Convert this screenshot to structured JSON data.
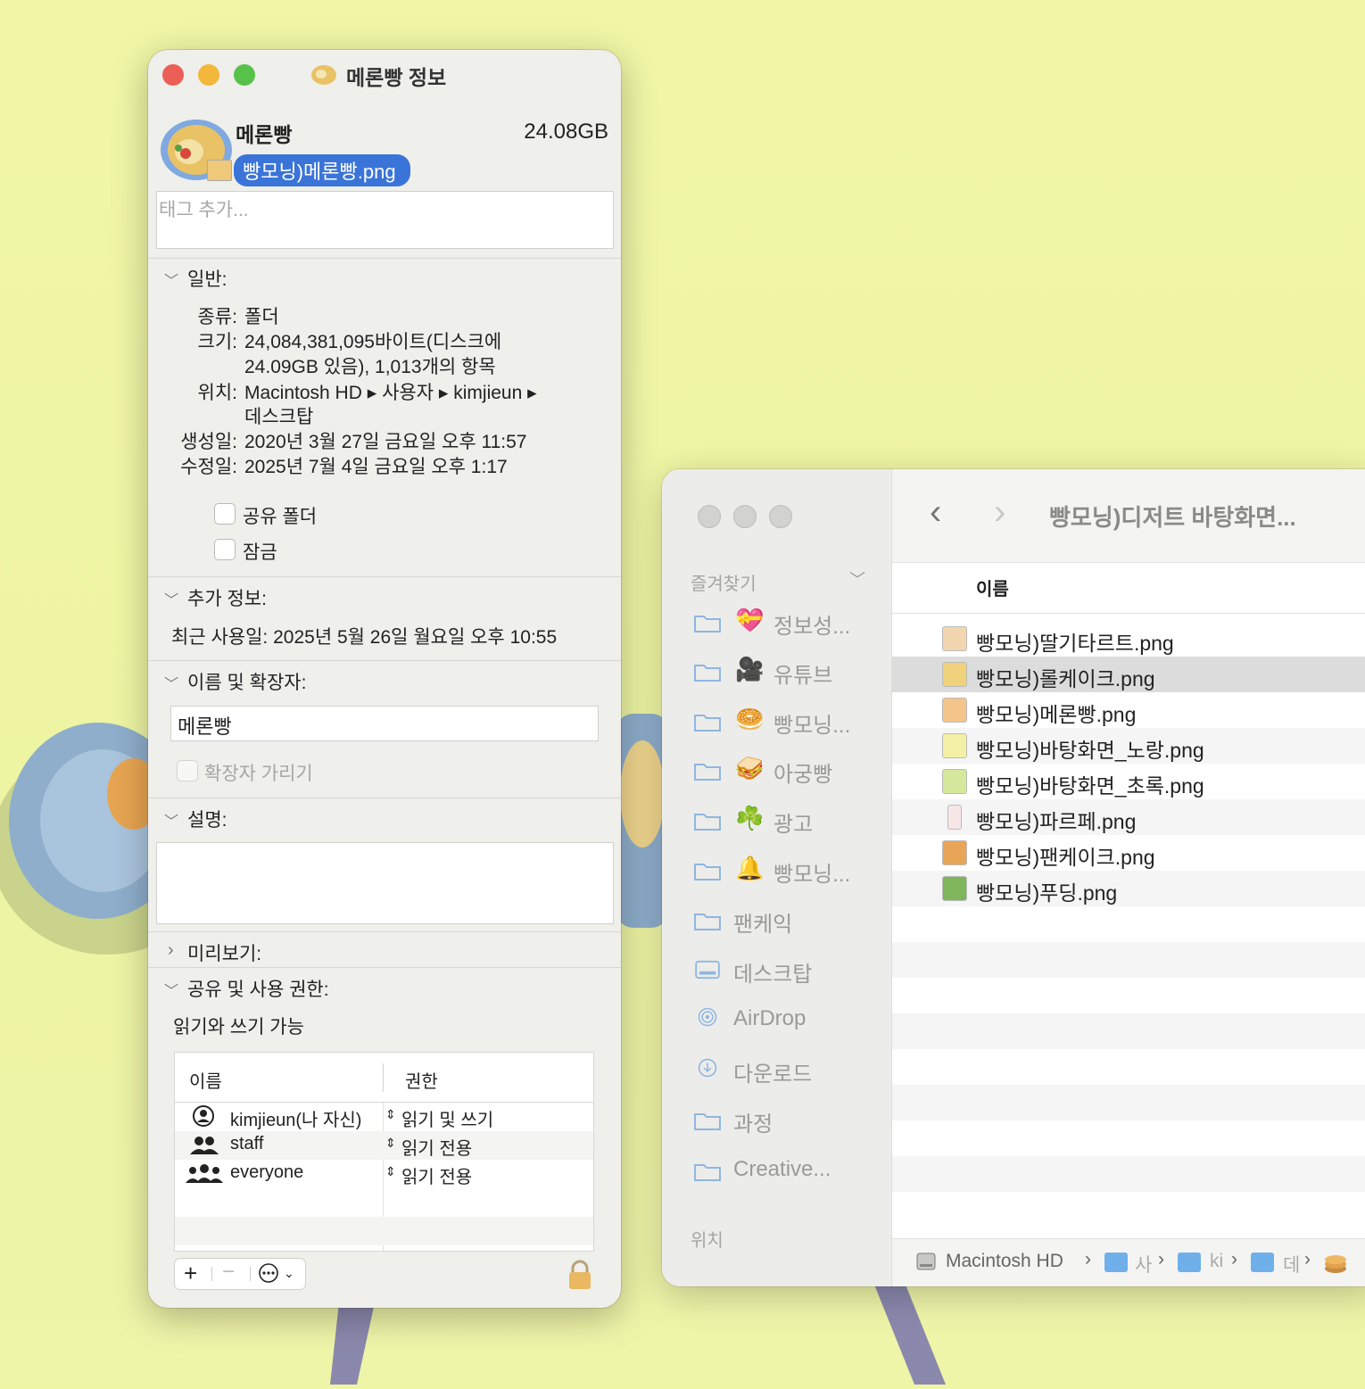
{
  "info_window": {
    "title": "메론빵 정보",
    "name": "메론빵",
    "size_summary": "24.08GB",
    "drag_label": "빵모닝)메론빵.png",
    "tags_placeholder": "태그 추가...",
    "general": {
      "header": "일반:",
      "kind_label": "종류:",
      "kind_value": "폴더",
      "size_label": "크기:",
      "size_value_1": "24,084,381,095바이트(디스크에",
      "size_value_2": "24.09GB 있음), 1,013개의 항목",
      "where_label": "위치:",
      "where_value_1": "Macintosh HD ▸ 사용자 ▸ kimjieun ▸",
      "where_value_2": "데스크탑",
      "created_label": "생성일:",
      "created_value": "2020년 3월 27일 금요일 오후 11:57",
      "modified_label": "수정일:",
      "modified_value": "2025년 7월 4일 금요일 오후 1:17",
      "shared_folder": "공유 폴더",
      "locked": "잠금"
    },
    "more_info": {
      "header": "추가 정보:",
      "last_opened": "최근 사용일: 2025년 5월 26일 월요일 오후 10:55"
    },
    "name_ext": {
      "header": "이름 및 확장자:",
      "value": "메론빵",
      "hide_ext": "확장자 가리기"
    },
    "comments": {
      "header": "설명:"
    },
    "preview": {
      "header": "미리보기:"
    },
    "sharing": {
      "header": "공유 및 사용 권한:",
      "status": "읽기와 쓰기 가능",
      "col_name": "이름",
      "col_priv": "권한",
      "rows": [
        {
          "name": "kimjieun(나 자신)",
          "priv": "읽기 및 쓰기"
        },
        {
          "name": "staff",
          "priv": "읽기 전용"
        },
        {
          "name": "everyone",
          "priv": "읽기 전용"
        }
      ]
    }
  },
  "finder": {
    "title": "빵모닝)디저트 바탕화면...",
    "favorites_label": "즐겨찾기",
    "locations_label": "위치",
    "sidebar": [
      {
        "emoji": "💝",
        "label": "정보성..."
      },
      {
        "emoji": "🎥",
        "label": "유튜브"
      },
      {
        "emoji": "🥯",
        "label": "빵모닝..."
      },
      {
        "emoji": "🥪",
        "label": "아궁빵"
      },
      {
        "emoji": "☘️",
        "label": "광고"
      },
      {
        "emoji": "🔔",
        "label": "빵모닝..."
      },
      {
        "emoji": "",
        "label": "팬케익"
      },
      {
        "emoji": "",
        "label": "데스크탑"
      },
      {
        "emoji": "",
        "label": "AirDrop"
      },
      {
        "emoji": "",
        "label": "다운로드"
      },
      {
        "emoji": "",
        "label": "과정"
      },
      {
        "emoji": "",
        "label": "Creative..."
      }
    ],
    "column_name": "이름",
    "files": [
      "빵모닝)딸기타르트.png",
      "빵모닝)롤케이크.png",
      "빵모닝)메론빵.png",
      "빵모닝)바탕화면_노랑.png",
      "빵모닝)바탕화면_초록.png",
      "빵모닝)파르페.png",
      "빵모닝)팬케이크.png",
      "빵모닝)푸딩.png"
    ],
    "path": [
      "Macintosh HD",
      "사",
      "ki",
      "데"
    ]
  }
}
